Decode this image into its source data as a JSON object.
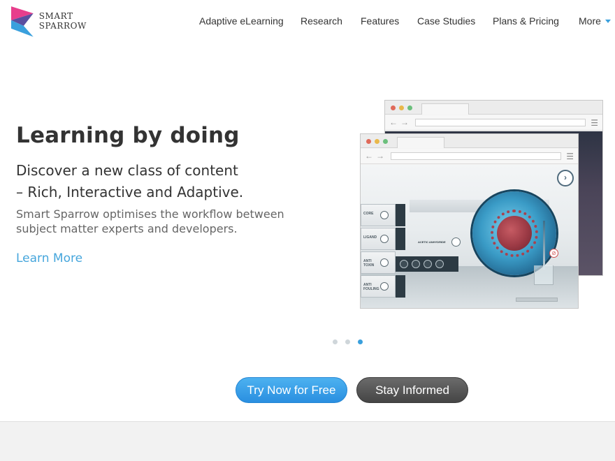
{
  "brand": {
    "line1": "SMART",
    "line2": "SPARROW",
    "colors": {
      "pink": "#e83e8c",
      "blue": "#3aa0dd",
      "purple": "#5b4fa0"
    }
  },
  "nav": {
    "items": [
      {
        "label": "Adaptive eLearning"
      },
      {
        "label": "Research"
      },
      {
        "label": "Features"
      },
      {
        "label": "Case Studies"
      },
      {
        "label": "Plans & Pricing"
      },
      {
        "label": "More"
      }
    ]
  },
  "hero": {
    "title": "Learning by doing",
    "subtitle_line1": "Discover a new class of content",
    "subtitle_line2": "– Rich, Interactive and Adaptive.",
    "desc_line1": "Smart Sparrow optimises the workflow between",
    "desc_line2": "subject matter experts and developers.",
    "learn_more": "Learn More"
  },
  "mockup": {
    "panels": [
      {
        "label": "CORE"
      },
      {
        "label": "LIGAND"
      },
      {
        "label": "ANTI TOXIN"
      },
      {
        "label": "ANTI FOULING"
      }
    ],
    "acetic_label": "ACETIC ANHYDRIDE"
  },
  "carousel": {
    "slide_count": 3,
    "active_index": 2
  },
  "cta": {
    "try_label": "Try Now for Free",
    "stay_label": "Stay Informed"
  },
  "colors": {
    "accent": "#3aa0dd",
    "cta_blue": "#2a8fe0",
    "cta_dark": "#454545"
  }
}
